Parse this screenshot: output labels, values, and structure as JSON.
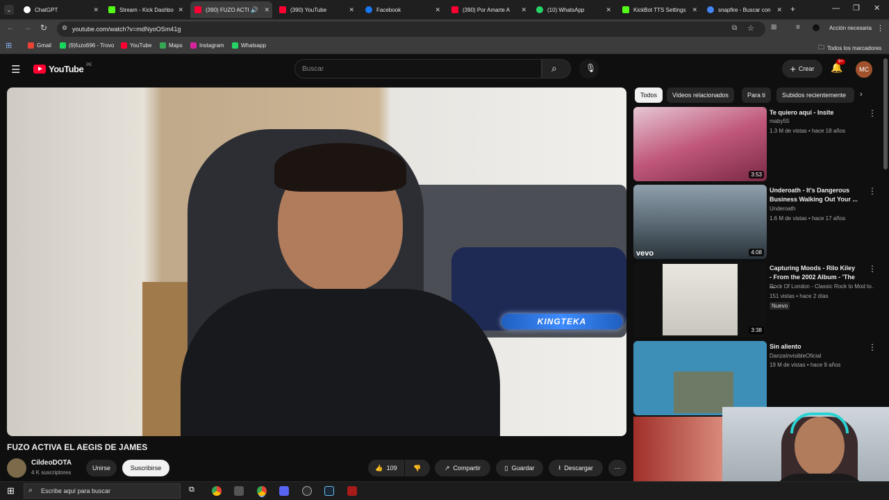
{
  "browser": {
    "tabs": [
      {
        "label": "ChatGPT",
        "color": "#ffffff"
      },
      {
        "label": "Stream - Kick Dashbo",
        "color": "#53fc18"
      },
      {
        "label": "(390) FUZO ACTI",
        "color": "#ff0033"
      },
      {
        "label": "(390) YouTube",
        "color": "#ff0033"
      },
      {
        "label": "Facebook",
        "color": "#1877f2"
      },
      {
        "label": "(390) Por Amarte A",
        "color": "#ff0033"
      },
      {
        "label": "(10) WhatsApp",
        "color": "#25d366"
      },
      {
        "label": "KickBot TTS Settings",
        "color": "#53fc18"
      },
      {
        "label": "snapfire - Buscar con",
        "color": "#4285f4"
      }
    ],
    "url": "youtube.com/watch?v=mdNyoOSm41g",
    "action_label": "Acción necesaria",
    "bookmarks": [
      {
        "label": "Gmail",
        "color": "#ea4335"
      },
      {
        "label": "(9)fuzo696 - Trovo",
        "color": "#19d65c"
      },
      {
        "label": "YouTube",
        "color": "#ff0033"
      },
      {
        "label": "Maps",
        "color": "#34a853"
      },
      {
        "label": "Instagram",
        "color": "#d6249f"
      },
      {
        "label": "Whatsapp",
        "color": "#25d366"
      }
    ],
    "all_bookmarks": "Todos los marcadores"
  },
  "youtube": {
    "logo": "YouTube",
    "logo_sup": "PE",
    "search_placeholder": "Buscar",
    "create_label": "Crear",
    "notif_badge": "9+",
    "avatar": "MC"
  },
  "video": {
    "overlay_text": "KINGTEKA",
    "title": "FUZO ACTIVA EL AEGIS DE JAMES",
    "channel": "CildeoDOTA",
    "subs": "4 K suscriptores",
    "join": "Unirse",
    "subscribe": "Suscribirse",
    "likes": "109",
    "share": "Compartir",
    "save": "Guardar",
    "download": "Descargar"
  },
  "sidebar": {
    "chips": [
      "Todos",
      "Videos relacionados",
      "Para ti",
      "Subidos recientemente"
    ],
    "recs": [
      {
        "title": "Te quiero aquí - Insite",
        "channel": "maby55",
        "meta": "1.3 M de vistas • hace 18 años",
        "duration": "3:53",
        "thumb": "#c0577a"
      },
      {
        "title": "Underoath - It's Dangerous Business Walking Out Your ...",
        "channel": "Underoath",
        "meta": "1.6 M de vistas • hace 17 años",
        "duration": "4:08",
        "thumb": "#52616b"
      },
      {
        "title": "Capturing Moods - Rilo Kiley - From the 2002 Album - 'The ...",
        "channel": "Rock Of London - Classic Rock to Mod to...",
        "meta": "151 vistas • hace 2 días",
        "badge": "Nuevo",
        "duration": "3:38",
        "thumb": "#d8d6cf"
      },
      {
        "title": "Sin aliento",
        "channel": "DanzaInvisibleOficial",
        "meta": "19 M de vistas • hace 9 años",
        "duration": "",
        "thumb": "#3e8fb8"
      }
    ]
  },
  "taskbar": {
    "search_placeholder": "Escribe aquí para buscar"
  }
}
